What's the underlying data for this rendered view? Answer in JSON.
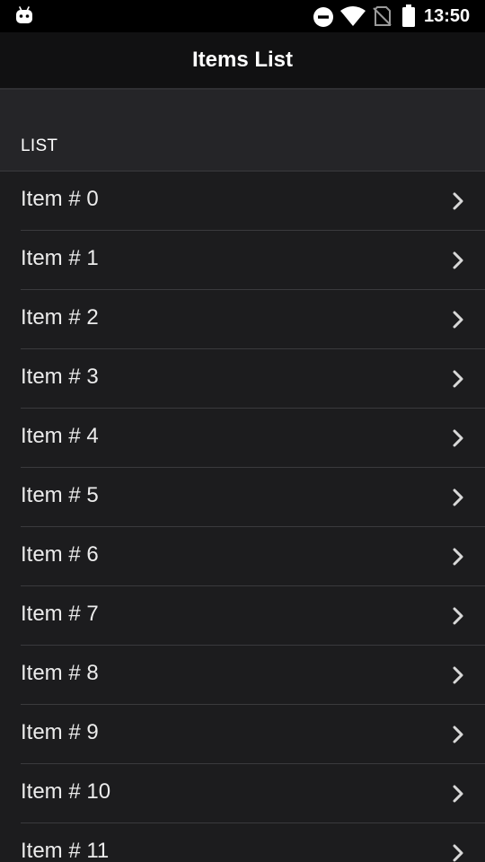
{
  "status_bar": {
    "time": "13:50",
    "icons": [
      "android-icon",
      "do-not-disturb-icon",
      "wifi-icon",
      "no-sim-icon",
      "battery-icon"
    ]
  },
  "nav": {
    "title": "Items List"
  },
  "section": {
    "header": "LIST"
  },
  "list": {
    "items": [
      {
        "label": "Item # 0"
      },
      {
        "label": "Item # 1"
      },
      {
        "label": "Item # 2"
      },
      {
        "label": "Item # 3"
      },
      {
        "label": "Item # 4"
      },
      {
        "label": "Item # 5"
      },
      {
        "label": "Item # 6"
      },
      {
        "label": "Item # 7"
      },
      {
        "label": "Item # 8"
      },
      {
        "label": "Item # 9"
      },
      {
        "label": "Item # 10"
      },
      {
        "label": "Item # 11"
      }
    ]
  },
  "colors": {
    "background": "#1c1c1e",
    "nav_background": "#111112",
    "section_background": "#252528",
    "separator": "#3a3a3d",
    "text": "#ececec",
    "chevron": "#d8d8d8"
  }
}
